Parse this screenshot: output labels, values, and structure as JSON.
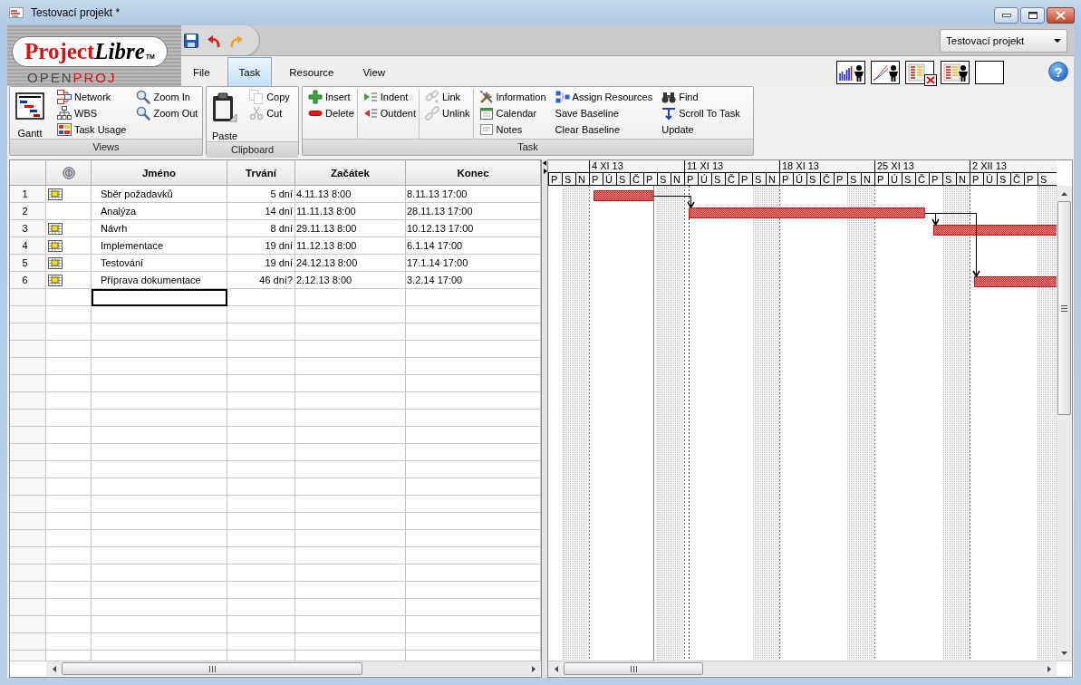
{
  "window": {
    "title": "Testovací projekt *"
  },
  "logo": {
    "parts": [
      "Project",
      "Libre"
    ],
    "mark": "TM",
    "subtitle_parts": [
      "OPEN",
      "PROJ"
    ]
  },
  "project_selector": {
    "value": "Testovací projekt"
  },
  "menu_tabs": [
    {
      "label": "File",
      "selected": false
    },
    {
      "label": "Task",
      "selected": true
    },
    {
      "label": "Resource",
      "selected": false
    },
    {
      "label": "View",
      "selected": false
    }
  ],
  "help_button": {
    "label": "?"
  },
  "ribbon": {
    "groups": [
      {
        "label": "Views",
        "sections": [
          [
            [
              {
                "label": "Gantt",
                "kind": "large",
                "disabled": false
              }
            ],
            [
              {
                "label": "Network",
                "kind": "small",
                "disabled": false
              },
              {
                "label": "WBS",
                "kind": "small",
                "disabled": false
              },
              {
                "label": "Task Usage",
                "kind": "small",
                "disabled": false
              }
            ],
            [
              {
                "label": "Zoom In",
                "kind": "small",
                "disabled": false
              },
              {
                "label": "Zoom Out",
                "kind": "small",
                "disabled": false
              }
            ]
          ]
        ]
      },
      {
        "label": "Clipboard",
        "sections": [
          [
            [
              {
                "label": "Paste",
                "kind": "large",
                "disabled": false
              }
            ],
            [
              {
                "label": "Copy",
                "kind": "small",
                "disabled": true
              },
              {
                "label": "Cut",
                "kind": "small",
                "disabled": true
              }
            ]
          ]
        ]
      },
      {
        "label": "Task",
        "sections": [
          [
            [
              {
                "label": "Insert",
                "kind": "small",
                "disabled": false
              },
              {
                "label": "Delete",
                "kind": "small",
                "disabled": false
              }
            ]
          ],
          [
            [
              {
                "label": "Indent",
                "kind": "small",
                "disabled": false
              },
              {
                "label": "Outdent",
                "kind": "small",
                "disabled": false
              }
            ]
          ],
          [
            [
              {
                "label": "Link",
                "kind": "small",
                "disabled": true
              },
              {
                "label": "Unlink",
                "kind": "small",
                "disabled": true
              }
            ]
          ],
          [
            [
              {
                "label": "Information",
                "kind": "small",
                "disabled": false
              },
              {
                "label": "Calendar",
                "kind": "small",
                "disabled": false
              },
              {
                "label": "Notes",
                "kind": "small",
                "disabled": false
              }
            ],
            [
              {
                "label": "Assign Resources",
                "kind": "small",
                "disabled": false
              },
              {
                "label": "Save Baseline",
                "kind": "small"
              },
              {
                "label": "Clear Baseline",
                "kind": "small"
              }
            ],
            [
              {
                "label": "Find",
                "kind": "small",
                "disabled": false
              },
              {
                "label": "Scroll To Task",
                "kind": "small",
                "disabled": false
              },
              {
                "label": "Update",
                "kind": "small"
              }
            ]
          ]
        ]
      }
    ]
  },
  "table": {
    "columns": [
      {
        "label": "Jméno"
      },
      {
        "label": "Trvání"
      },
      {
        "label": "Začátek"
      },
      {
        "label": "Konec"
      }
    ],
    "rows": [
      {
        "number": "1",
        "indicator": true,
        "name": "Sběr požadavků",
        "duration": "5 dní",
        "start": "4.11.13 8:00",
        "finish": "8.11.13 17:00"
      },
      {
        "number": "2",
        "indicator": false,
        "name": "Analýza",
        "duration": "14 dní",
        "start": "11.11.13 8:00",
        "finish": "28.11.13 17:00",
        "linked": true
      },
      {
        "number": "3",
        "indicator": true,
        "name": "Návrh",
        "duration": "8 dní",
        "start": "29.11.13 8:00",
        "finish": "10.12.13 17:00",
        "linked": true
      },
      {
        "number": "4",
        "indicator": true,
        "name": "Implementace",
        "duration": "19 dní",
        "start": "11.12.13 8:00",
        "finish": "6.1.14 17:00"
      },
      {
        "number": "5",
        "indicator": true,
        "name": "Testování",
        "duration": "19 dní",
        "start": "24.12.13 8:00",
        "finish": "17.1.14 17:00"
      },
      {
        "number": "6",
        "indicator": true,
        "name": "Příprava dokumentace",
        "duration": "46 dní?",
        "start": "2.12.13 8:00",
        "finish": "3.2.14 17:00",
        "linked": true
      }
    ],
    "entry_row": {
      "selected": true
    }
  },
  "gantt": {
    "weeks": [
      {
        "days": [
          "P",
          "S",
          "N"
        ]
      },
      {
        "label": "4 XI 13",
        "days": [
          "P",
          "Ú",
          "S",
          "Č",
          "P",
          "S",
          "N"
        ]
      },
      {
        "label": "11 XI 13",
        "days": [
          "P",
          "Ú",
          "S",
          "Č",
          "P",
          "S",
          "N"
        ]
      },
      {
        "label": "18 XI 13",
        "days": [
          "P",
          "Ú",
          "S",
          "Č",
          "P",
          "S",
          "N"
        ]
      },
      {
        "label": "25 XI 13",
        "days": [
          "P",
          "Ú",
          "S",
          "Č",
          "P",
          "S",
          "N"
        ]
      },
      {
        "label": "2 XII 13",
        "days": [
          "P",
          "Ú",
          "S",
          "Č",
          "P",
          "S"
        ]
      }
    ]
  }
}
